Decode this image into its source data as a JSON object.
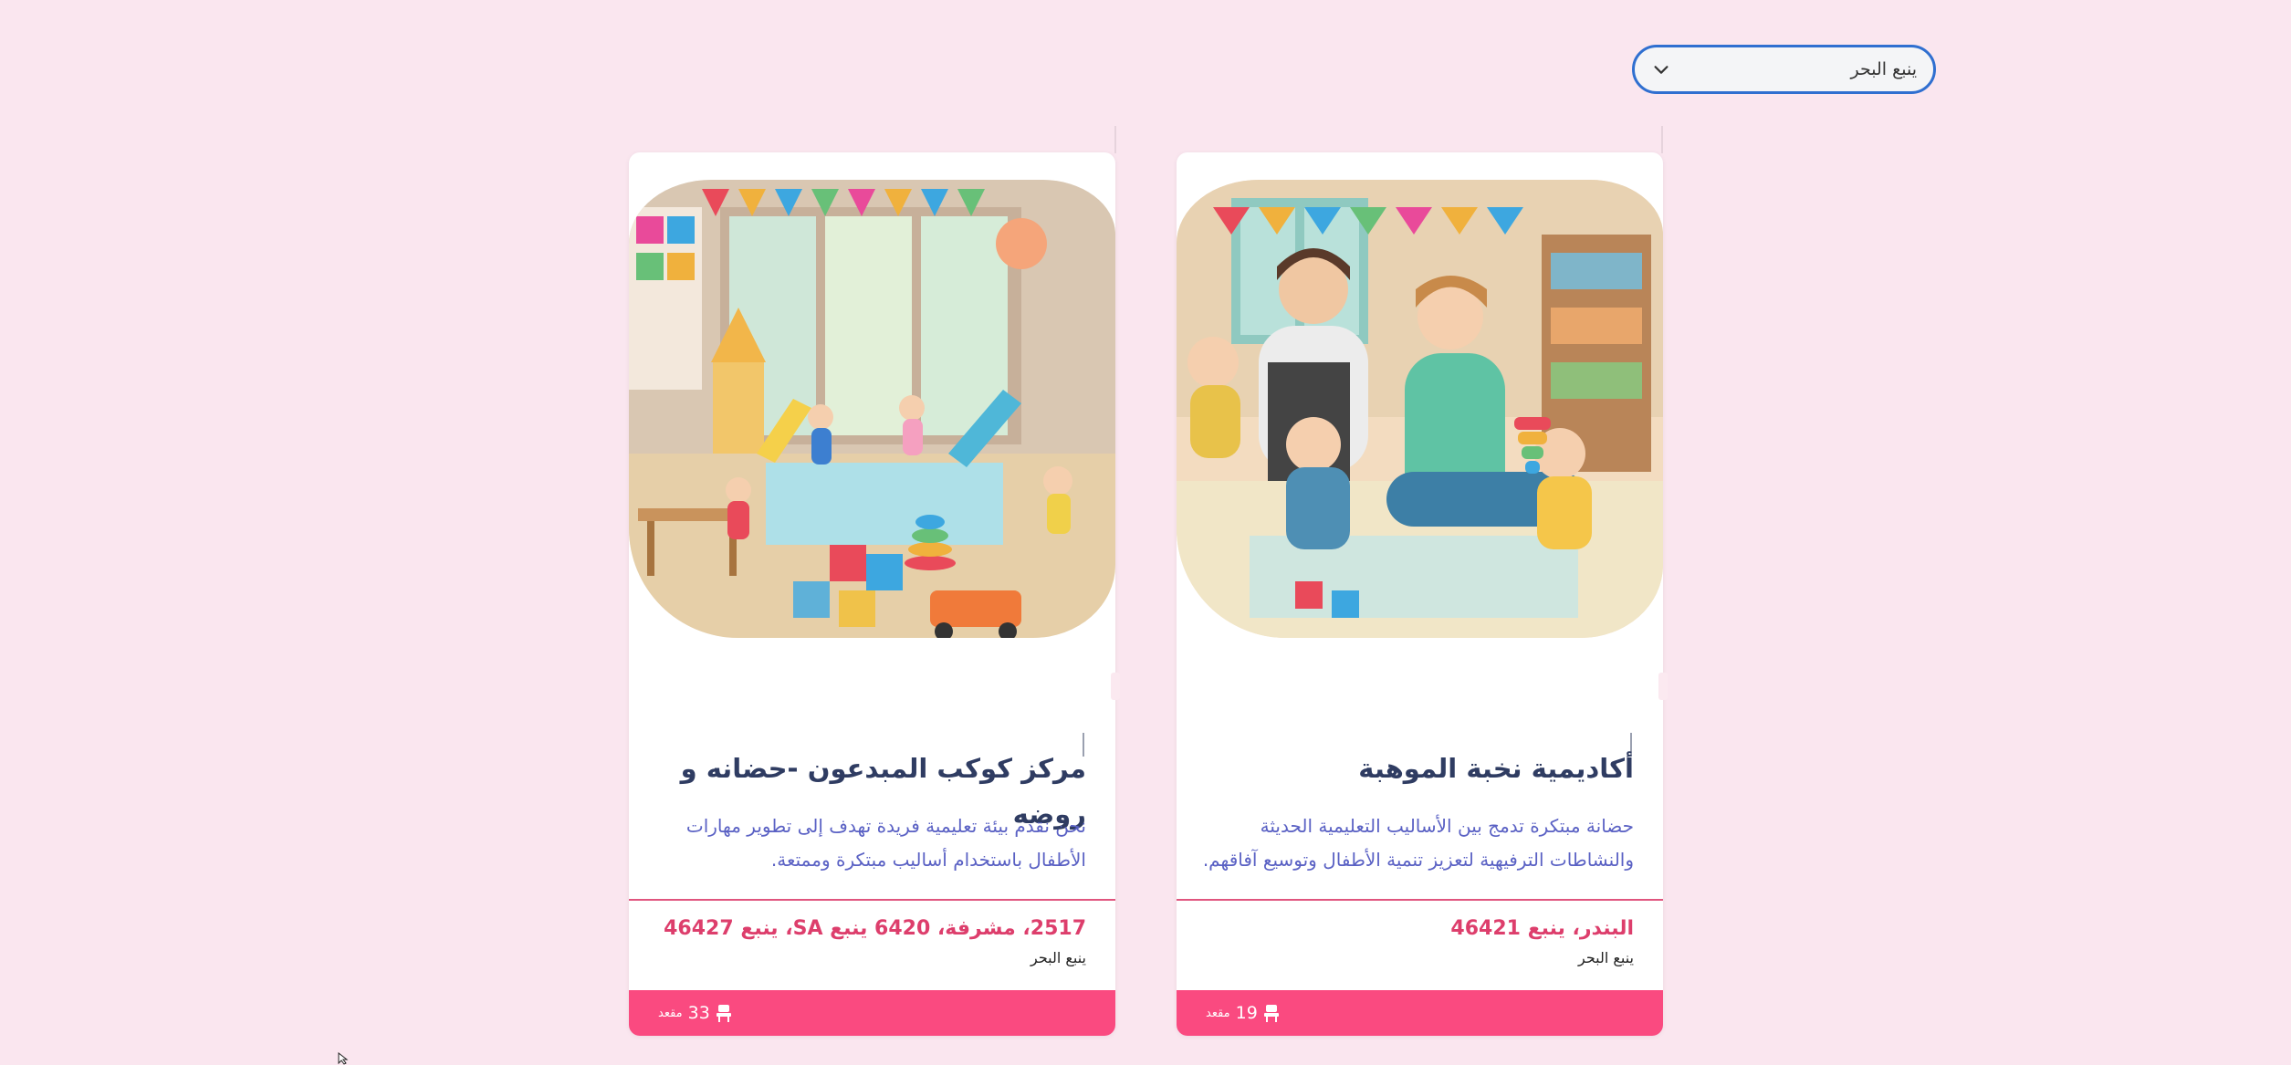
{
  "filter": {
    "selected_city": "ينبع البحر",
    "icon": "chevron-down-icon"
  },
  "cards": [
    {
      "title": "أكاديمية نخبة الموهبة",
      "description": "حضانة مبتكرة تدمج بين الأساليب التعليمية الحديثة والنشاطات الترفيهية لتعزيز تنمية الأطفال وتوسيع آفاقهم.",
      "address": "البندر، ينبع 46421",
      "city": "ينبع البحر",
      "seats_count": "19",
      "seats_label": "مقعد",
      "image_alt": "teachers-reading-with-toddlers-illustration"
    },
    {
      "title": "مركز كوكب المبدعون -حضانه و روضه",
      "description": "نحن نقدم بيئة تعليمية فريدة تهدف إلى تطوير مهارات الأطفال باستخدام أساليب مبتكرة وممتعة.",
      "address": "2517، مشرفة، 6420 ينبع SA، ينبع 46427",
      "city": "ينبع البحر",
      "seats_count": "33",
      "seats_label": "مقعد",
      "image_alt": "kids-playroom-with-slides-illustration"
    }
  ],
  "colors": {
    "background": "#fae6ef",
    "accent": "#fa4a80",
    "title": "#2f3c62",
    "description": "#5a61c4",
    "address": "#dd3e6c",
    "select_border": "#2f6fd0"
  }
}
